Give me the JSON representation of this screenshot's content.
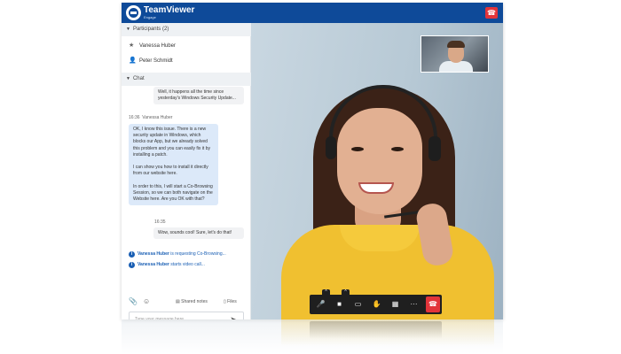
{
  "app": {
    "name": "TeamViewer",
    "sub": "Engage"
  },
  "participants": {
    "header": "Participants (2)",
    "items": [
      {
        "name": "Vanessa Huber",
        "icon": "star-icon"
      },
      {
        "name": "Peter Schmidt",
        "icon": "person-icon"
      }
    ]
  },
  "chat": {
    "header": "Chat",
    "messages": [
      {
        "from": "out",
        "text": "Well, it happens all the time since yesterday's Windows Security Update..."
      },
      {
        "from": "in",
        "time": "16:36",
        "sender": "Vanessa Huber",
        "text": "OK, I know this issue. There is a new security update in Windows, which blocks our App, but we already solved this problem and you can easily fix it by installing a patch.\n\nI can show you how to install it directly from our website here.\n\nIn order to this, I will start a Co-Browsing Session, so we can both navigate on the Website here. Are you OK with that?"
      },
      {
        "from": "out",
        "time": "16:35",
        "text": "Wow, sounds cool! Sure, let's do that!"
      }
    ],
    "notices": [
      {
        "name": "Vanessa Huber",
        "text": "is requesting Co-Browsing..."
      },
      {
        "name": "Vanessa Huber",
        "text": "starts video call..."
      }
    ]
  },
  "toolbar": {
    "shared_notes": "Shared notes",
    "files": "Files"
  },
  "input": {
    "placeholder": "Type your message here..."
  },
  "controls": [
    "mic-icon",
    "camera-icon",
    "screen-share-icon",
    "hand-icon",
    "layout-icon",
    "more-icon"
  ],
  "colors": {
    "brand": "#0e4a99",
    "end_call": "#e2343a",
    "shirt": "#f0c030"
  }
}
